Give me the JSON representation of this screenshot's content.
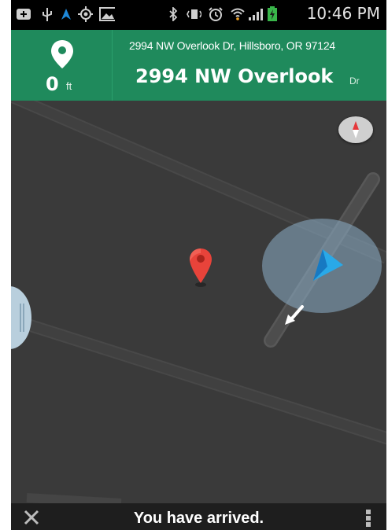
{
  "status_bar": {
    "time": "10:46 PM",
    "icons": [
      "plus-icon",
      "usb-icon",
      "navigation-icon",
      "gps-icon",
      "image-icon",
      "bluetooth-icon",
      "vibrate-icon",
      "alarm-icon",
      "wifi-icon",
      "signal-icon",
      "battery-charging-icon"
    ],
    "battery_color": "#39b54a"
  },
  "nav_header": {
    "destination_icon": "destination-pin-icon",
    "distance_value": "0",
    "distance_unit": "ft",
    "full_address": "2994 NW Overlook Dr, Hillsboro, OR 97124",
    "street_name": "2994 NW Overlook",
    "street_suffix": "Dr",
    "header_color": "#1f8a5c"
  },
  "map": {
    "compass_icon": "compass-icon",
    "destination_marker": "red-map-pin-icon",
    "position_marker": "blue-navigation-arrow-icon",
    "direction_hint": "white-direction-arrow-icon",
    "background_color": "#3a3a3a",
    "road_color": "#4b4b4b"
  },
  "bottom_bar": {
    "close_icon": "close-icon",
    "message": "You have arrived.",
    "menu_icon": "overflow-menu-icon"
  }
}
